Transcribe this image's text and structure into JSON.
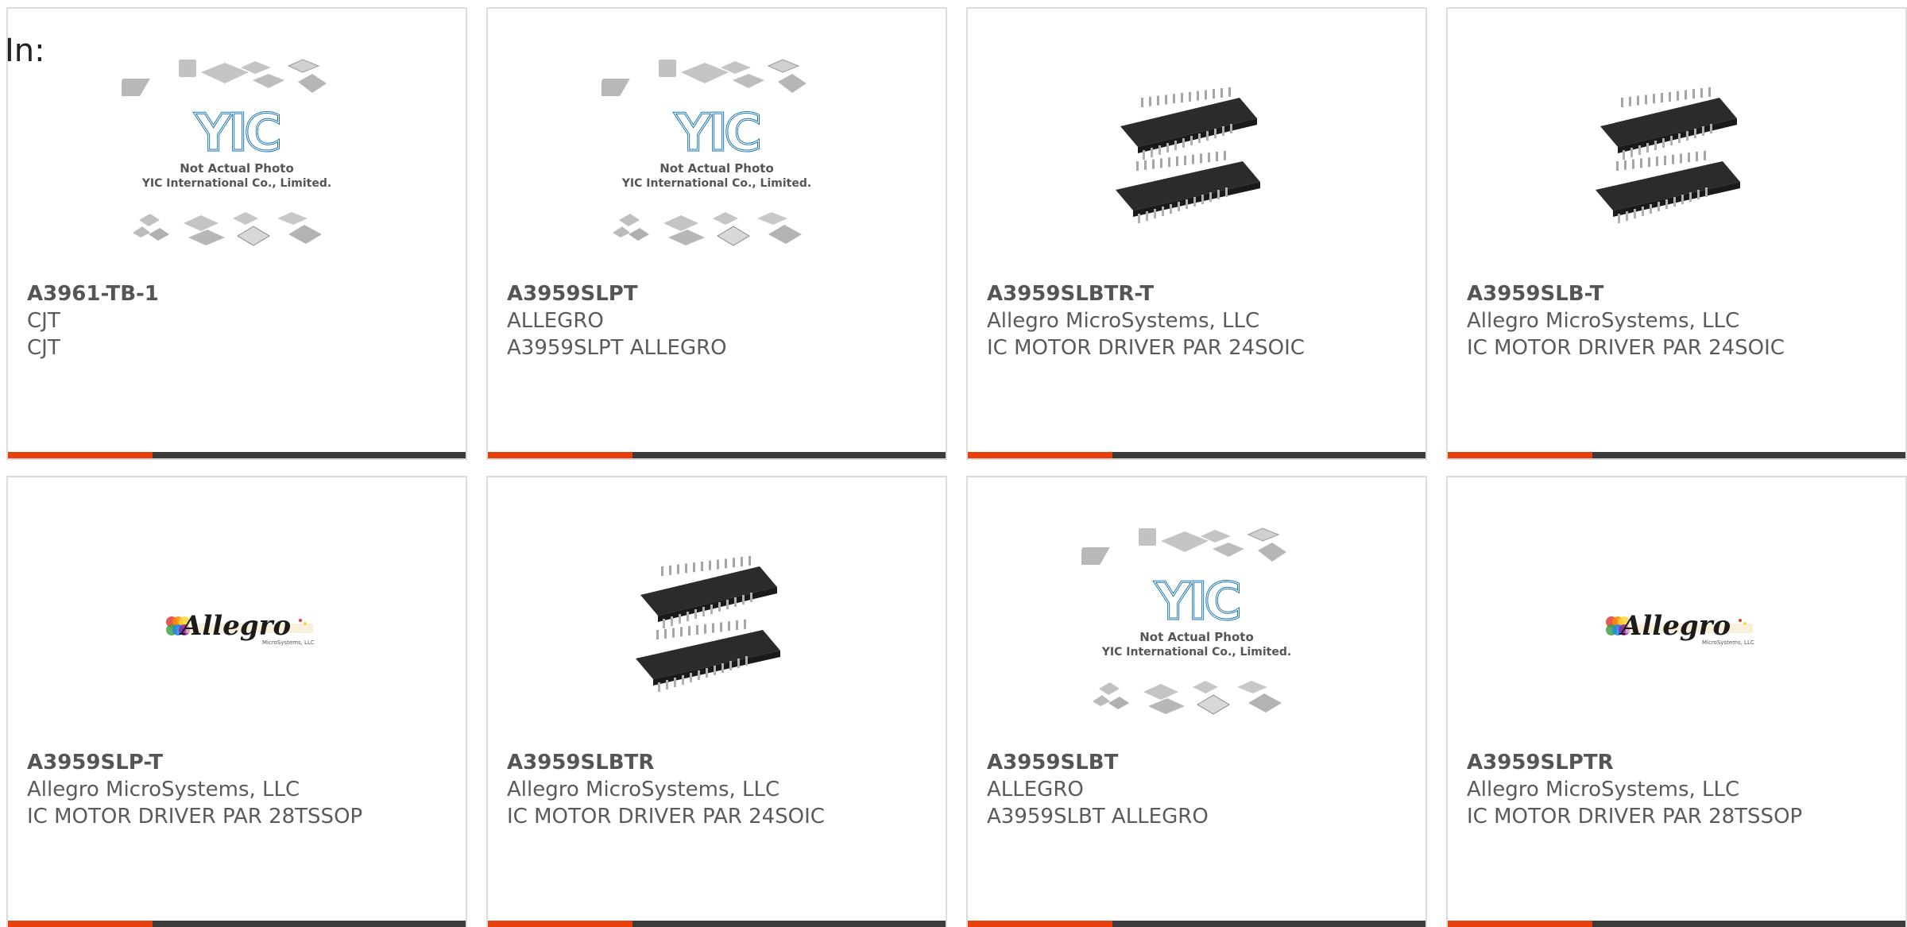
{
  "page": {
    "prefix_label": "In:"
  },
  "colors": {
    "bar_accent": "#e8400d",
    "bar_rest": "#3c3c3c"
  },
  "cards": [
    {
      "part_number": "A3961-TB-1",
      "manufacturer": "CJT",
      "description": "CJT",
      "image": "not-actual-photo",
      "placeholder_line1": "Not Actual Photo",
      "placeholder_line2": "YIC International Co., Limited.",
      "logo_text": "YIC"
    },
    {
      "part_number": "A3959SLPT",
      "manufacturer": "ALLEGRO",
      "description": "A3959SLPT ALLEGRO",
      "image": "not-actual-photo",
      "placeholder_line1": "Not Actual Photo",
      "placeholder_line2": "YIC International Co., Limited.",
      "logo_text": "YIC"
    },
    {
      "part_number": "A3959SLBTR-T",
      "manufacturer": "Allegro MicroSystems, LLC",
      "description": "IC MOTOR DRIVER PAR 24SOIC",
      "image": "soic-chip-photo"
    },
    {
      "part_number": "A3959SLB-T",
      "manufacturer": "Allegro MicroSystems, LLC",
      "description": "IC MOTOR DRIVER PAR 24SOIC",
      "image": "soic-chip-photo"
    },
    {
      "part_number": "A3959SLP-T",
      "manufacturer": "Allegro MicroSystems, LLC",
      "description": "IC MOTOR DRIVER PAR 28TSSOP",
      "image": "allegro-logo",
      "logo_text": "Allegro",
      "logo_subtext": "MicroSystems, LLC"
    },
    {
      "part_number": "A3959SLBTR",
      "manufacturer": "Allegro MicroSystems, LLC",
      "description": "IC MOTOR DRIVER PAR 24SOIC",
      "image": "soic-chip-photo"
    },
    {
      "part_number": "A3959SLBT",
      "manufacturer": "ALLEGRO",
      "description": "A3959SLBT ALLEGRO",
      "image": "not-actual-photo",
      "placeholder_line1": "Not Actual Photo",
      "placeholder_line2": "YIC International Co., Limited.",
      "logo_text": "YIC"
    },
    {
      "part_number": "A3959SLPTR",
      "manufacturer": "Allegro MicroSystems, LLC",
      "description": "IC MOTOR DRIVER PAR 28TSSOP",
      "image": "allegro-logo",
      "logo_text": "Allegro",
      "logo_subtext": "MicroSystems, LLC"
    }
  ]
}
